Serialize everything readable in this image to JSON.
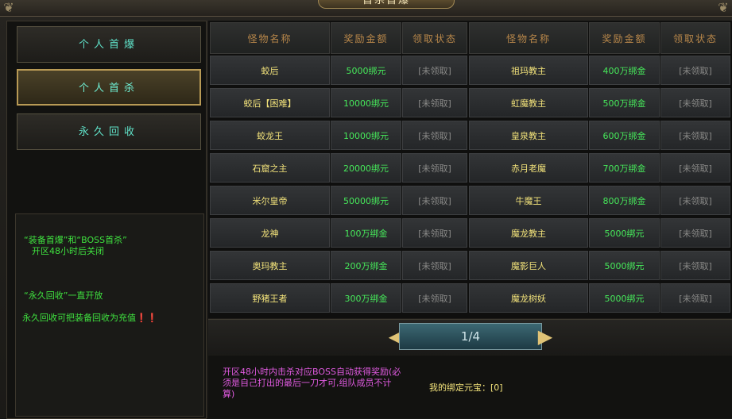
{
  "window": {
    "title": "首杀首爆"
  },
  "sidebar": {
    "buttons": [
      {
        "label": "个人首爆",
        "active": false
      },
      {
        "label": "个人首杀",
        "active": true
      },
      {
        "label": "永久回收",
        "active": false
      }
    ]
  },
  "info": {
    "lines": [
      "“装备首爆”和“BOSS首杀”",
      "开区48小时后关闭",
      "“永久回收”一直开放",
      "永久回收可把装备回收为充值❗❗"
    ]
  },
  "table": {
    "headers": [
      "怪物名称",
      "奖励金额",
      "领取状态",
      "怪物名称",
      "奖励金额",
      "领取状态"
    ],
    "rows": [
      {
        "left": {
          "name": "蛟后",
          "reward": "5000绑元",
          "status": "[未领取]"
        },
        "right": {
          "name": "祖玛教主",
          "reward": "400万绑金",
          "status": "[未领取]"
        }
      },
      {
        "left": {
          "name": "蛟后【困难】",
          "reward": "10000绑元",
          "status": "[未领取]"
        },
        "right": {
          "name": "虹魔教主",
          "reward": "500万绑金",
          "status": "[未领取]"
        }
      },
      {
        "left": {
          "name": "蛟龙王",
          "reward": "10000绑元",
          "status": "[未领取]"
        },
        "right": {
          "name": "皇泉教主",
          "reward": "600万绑金",
          "status": "[未领取]"
        }
      },
      {
        "left": {
          "name": "石窟之主",
          "reward": "20000绑元",
          "status": "[未领取]"
        },
        "right": {
          "name": "赤月老魔",
          "reward": "700万绑金",
          "status": "[未领取]"
        }
      },
      {
        "left": {
          "name": "米尔皇帝",
          "reward": "50000绑元",
          "status": "[未领取]"
        },
        "right": {
          "name": "牛魔王",
          "reward": "800万绑金",
          "status": "[未领取]"
        }
      },
      {
        "left": {
          "name": "龙神",
          "reward": "100万绑金",
          "status": "[未领取]"
        },
        "right": {
          "name": "魔龙教主",
          "reward": "5000绑元",
          "status": "[未领取]"
        }
      },
      {
        "left": {
          "name": "奥玛教主",
          "reward": "200万绑金",
          "status": "[未领取]"
        },
        "right": {
          "name": "魔影巨人",
          "reward": "5000绑元",
          "status": "[未领取]"
        }
      },
      {
        "left": {
          "name": "野猪王者",
          "reward": "300万绑金",
          "status": "[未领取]"
        },
        "right": {
          "name": "魔龙树妖",
          "reward": "5000绑元",
          "status": "[未领取]"
        }
      }
    ]
  },
  "pager": {
    "text": "1/4"
  },
  "footer": {
    "note": "开区48小时内击杀对应BOSS自动获得奖励(必须是自己打出的最后一刀才可,组队成员不计算)",
    "bound_label": "我的绑定元宝：[0]"
  },
  "icons": {
    "prev": "prev-page-arrow-icon",
    "next": "next-page-arrow-icon"
  },
  "colors": {
    "name": "#f2e27a",
    "reward": "#46e85a",
    "status": "#8a8a88",
    "header": "#b8874a",
    "note": "#e05ae0"
  }
}
